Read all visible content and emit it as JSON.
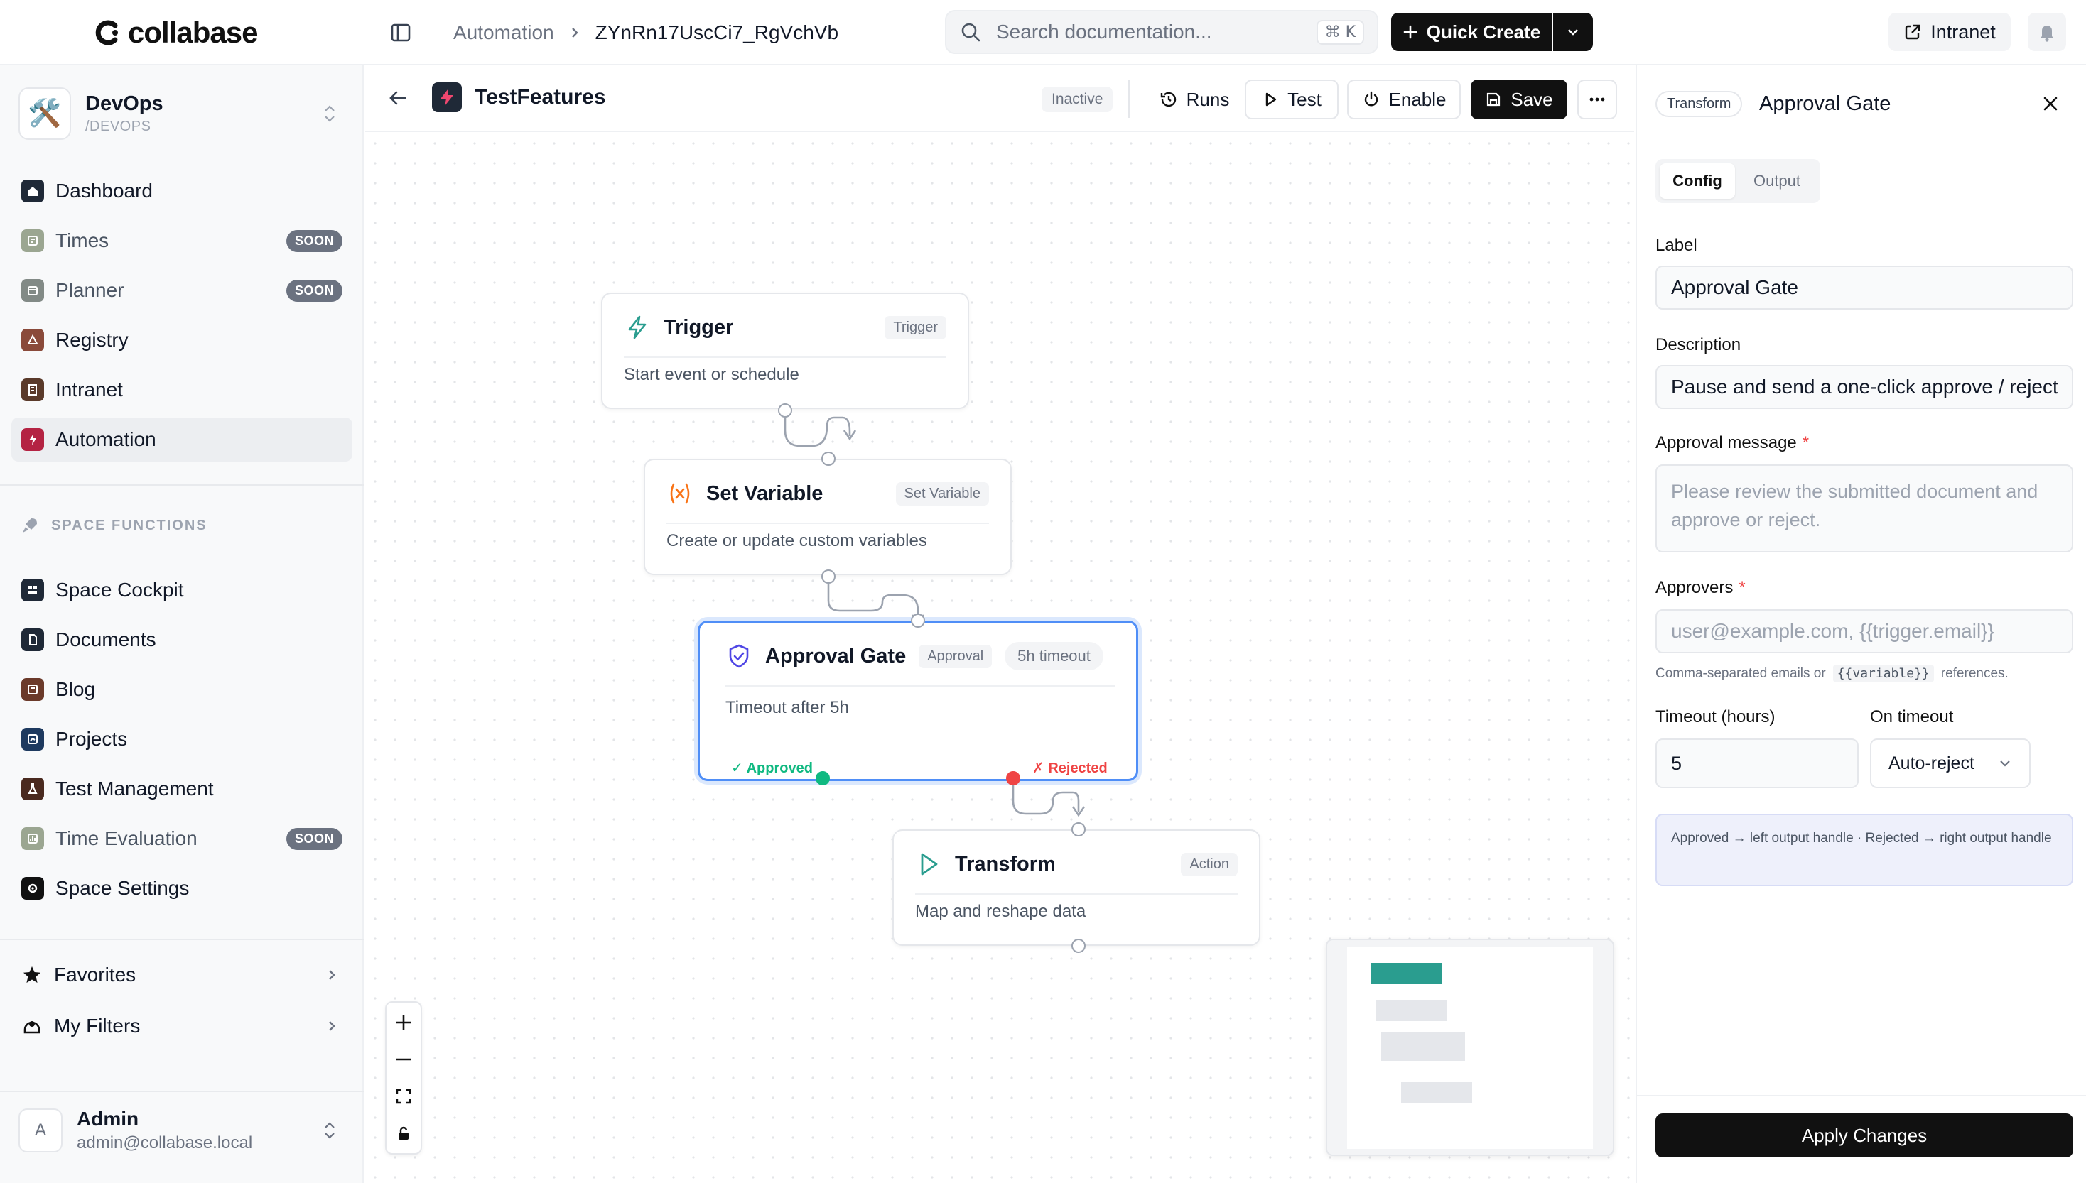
{
  "topbar": {
    "logo_text": "collabase",
    "breadcrumbs": [
      "Automation",
      "ZYnRn17UscCi7_RgVchVb"
    ],
    "search_placeholder": "Search documentation...",
    "search_shortcut": "⌘ K",
    "quick_create_label": "Quick Create",
    "intranet_label": "Intranet"
  },
  "sidebar": {
    "space": {
      "name": "DevOps",
      "slug": "/DEVOPS",
      "emoji": "🛠️"
    },
    "items": [
      {
        "label": "Dashboard",
        "icon": "home-icon",
        "color": "#1f2937",
        "soon": false,
        "active": false
      },
      {
        "label": "Times",
        "icon": "clock-icon",
        "color": "#7c8b6f",
        "soon": true,
        "active": false
      },
      {
        "label": "Planner",
        "icon": "calendar-icon",
        "color": "#5b6560",
        "soon": true,
        "active": false
      },
      {
        "label": "Registry",
        "icon": "registry-icon",
        "color": "#8a4a3a",
        "soon": false,
        "active": false
      },
      {
        "label": "Intranet",
        "icon": "building-icon",
        "color": "#5a3a2a",
        "soon": false,
        "active": false
      },
      {
        "label": "Automation",
        "icon": "bolt-icon",
        "color": "#b42343",
        "soon": false,
        "active": true
      }
    ],
    "soon_label": "SOON",
    "section_label": "SPACE FUNCTIONS",
    "functions": [
      {
        "label": "Space Cockpit",
        "icon": "cockpit-icon",
        "color": "#1f2937",
        "soon": false
      },
      {
        "label": "Documents",
        "icon": "document-icon",
        "color": "#1f2937",
        "soon": false
      },
      {
        "label": "Blog",
        "icon": "blog-icon",
        "color": "#6b3a2a",
        "soon": false
      },
      {
        "label": "Projects",
        "icon": "projects-icon",
        "color": "#1e3a5f",
        "soon": false
      },
      {
        "label": "Test Management",
        "icon": "flask-icon",
        "color": "#4a2a1f",
        "soon": false
      },
      {
        "label": "Time Evaluation",
        "icon": "chart-icon",
        "color": "#7c8b6f",
        "soon": true
      },
      {
        "label": "Space Settings",
        "icon": "gear-icon",
        "color": "#111111",
        "soon": false
      }
    ],
    "favorites_label": "Favorites",
    "filters_label": "My Filters",
    "user": {
      "initial": "A",
      "name": "Admin",
      "email": "admin@collabase.local"
    }
  },
  "workflow": {
    "title": "TestFeatures",
    "status": "Inactive",
    "runs_label": "Runs",
    "test_label": "Test",
    "enable_label": "Enable",
    "save_label": "Save"
  },
  "nodes": {
    "trigger": {
      "title": "Trigger",
      "tag": "Trigger",
      "desc": "Start event or schedule"
    },
    "setvar": {
      "title": "Set Variable",
      "tag": "Set Variable",
      "desc": "Create or update custom variables"
    },
    "approval": {
      "title": "Approval Gate",
      "tag": "Approval",
      "timeout_tag": "5h timeout",
      "desc": "Timeout after 5h",
      "approved_label": "✓ Approved",
      "rejected_label": "✗ Rejected"
    },
    "transform": {
      "title": "Transform",
      "tag": "Action",
      "desc": "Map and reshape data"
    }
  },
  "panel": {
    "type_tag": "Transform",
    "title": "Approval Gate",
    "tabs": [
      "Config",
      "Output"
    ],
    "label_field": {
      "label": "Label",
      "value": "Approval Gate"
    },
    "description_field": {
      "label": "Description",
      "value": "Pause and send a one-click approve / reject"
    },
    "message_field": {
      "label": "Approval message",
      "placeholder": "Please review the submitted document and approve or reject."
    },
    "approvers_field": {
      "label": "Approvers",
      "placeholder": "user@example.com, {{trigger.email}}"
    },
    "approvers_hint": {
      "before": "Comma-separated emails or",
      "code": "{{variable}}",
      "after": "references."
    },
    "timeout_field": {
      "label": "Timeout (hours)",
      "value": "5"
    },
    "on_timeout_field": {
      "label": "On timeout",
      "value": "Auto-reject"
    },
    "info": "Approved → left output handle · Rejected → right output handle",
    "apply_label": "Apply Changes"
  },
  "colors": {
    "accent": "#4f8ef7",
    "approved": "#10b981",
    "rejected": "#ef4444",
    "brand_dark": "#111111",
    "minimap_trigger": "#2a9d8f"
  }
}
